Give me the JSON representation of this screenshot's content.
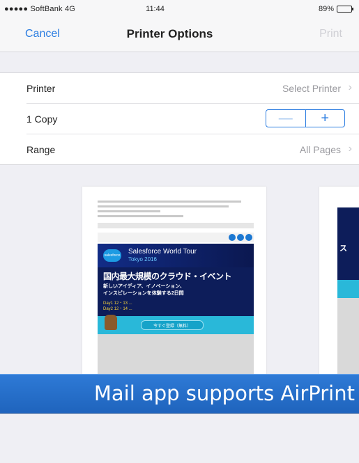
{
  "status_bar": {
    "carrier": "●●●●● SoftBank  4G",
    "time": "11:44",
    "battery_text": "89%",
    "battery_level": 0.89
  },
  "nav": {
    "cancel": "Cancel",
    "title": "Printer Options",
    "print": "Print"
  },
  "options": [
    {
      "label": "Printer",
      "value": "Select Printer",
      "chevron": "›"
    },
    {
      "label": "1 Copy",
      "minus": "—",
      "plus": "+"
    },
    {
      "label": "Range",
      "value": "All Pages",
      "chevron": "›"
    }
  ],
  "preview": {
    "banner_title_line1": "Salesforce World Tour",
    "banner_title_line2": "Tokyo 2016",
    "banner_main_jp": "国内最大規模のクラウド・イベント",
    "banner_jp_line1": "新しいアイディア、イノベーション、",
    "banner_jp_line2": "インスピレーションを体験する2日間",
    "date_line1": "Day1 12・13 ...",
    "date_line2": "Day2 12・14 ...",
    "register_label": "今すぐ登録（無料）",
    "second_page_glyph": "ス"
  },
  "caption": "Mail app supports AirPrint"
}
